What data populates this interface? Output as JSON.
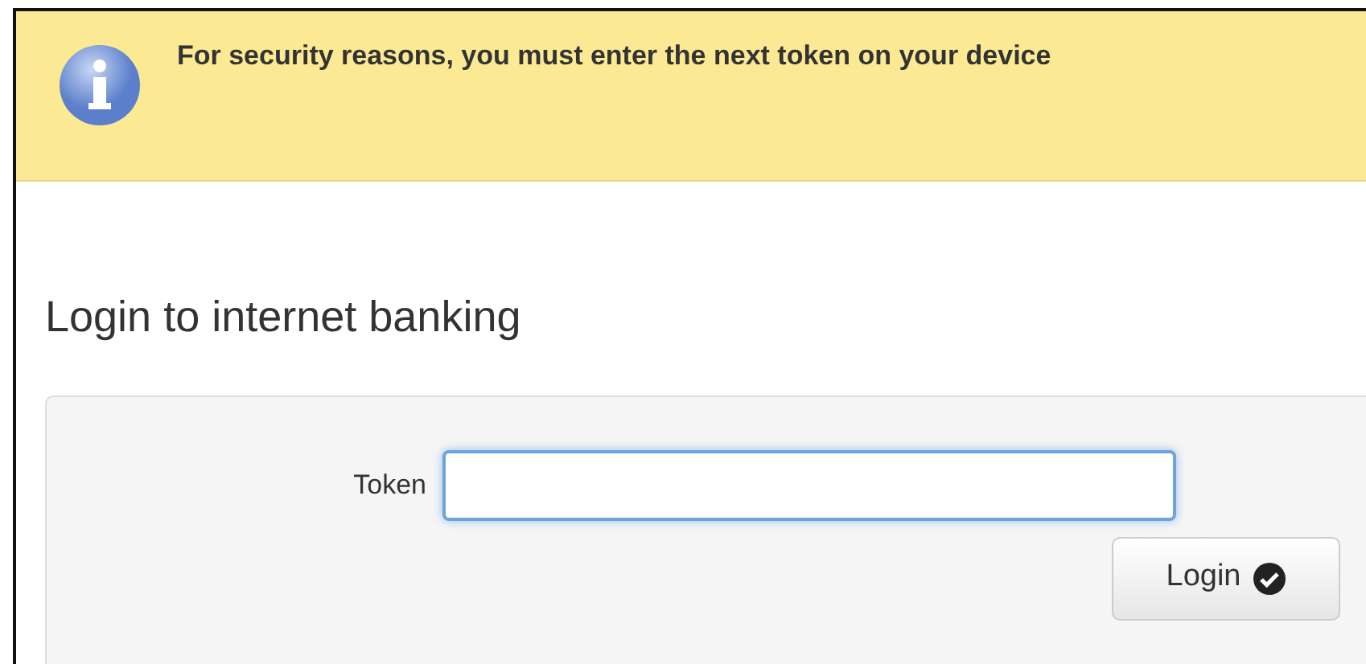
{
  "alert": {
    "text": "For security reasons, you must enter the next token on your device"
  },
  "heading": "Login to internet banking",
  "form": {
    "field": {
      "label": "Token",
      "focused": true
    },
    "button": {
      "label": "Login"
    }
  }
}
